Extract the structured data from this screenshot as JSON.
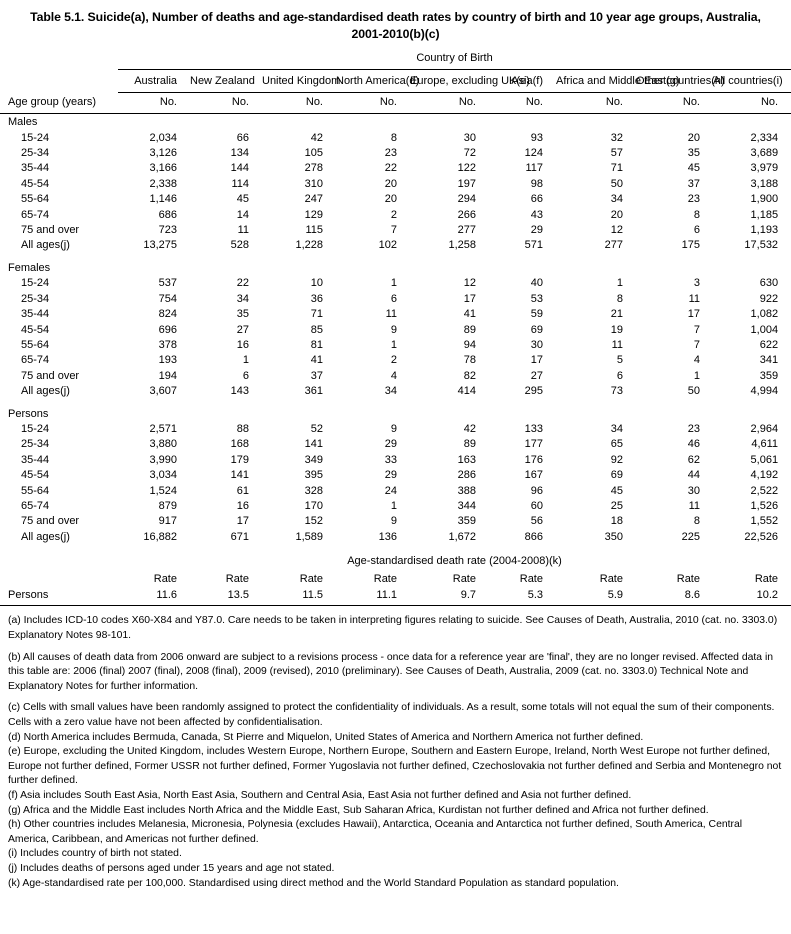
{
  "title": "Table 5.1. Suicide(a), Number of deaths and age-standardised death rates by country of birth and 10 year age groups, Australia, 2001-2010(b)(c)",
  "table": {
    "spanner_label": "Country of Birth",
    "stub_header": "Age group (years)",
    "columns": [
      "Australia",
      "New Zealand",
      "United Kingdom",
      "North America(d)",
      "Europe, excluding UK(e)",
      "Asia(f)",
      "Africa and Middle East(g)",
      "Other countries(h)",
      "All countries(i)"
    ],
    "unit_no": "No.",
    "unit_rate": "Rate",
    "rate_spanner_label": "Age-standardised death rate (2004-2008)(k)",
    "rate_row_label": "Persons",
    "rate_values": [
      "11.6",
      "13.5",
      "11.5",
      "11.1",
      "9.7",
      "5.3",
      "5.9",
      "8.6",
      "10.2"
    ],
    "groups": [
      {
        "name": "Males",
        "rows": [
          {
            "label": "15-24",
            "total": false,
            "values": [
              "2,034",
              "66",
              "42",
              "8",
              "30",
              "93",
              "32",
              "20",
              "2,334"
            ]
          },
          {
            "label": "25-34",
            "total": false,
            "values": [
              "3,126",
              "134",
              "105",
              "23",
              "72",
              "124",
              "57",
              "35",
              "3,689"
            ]
          },
          {
            "label": "35-44",
            "total": false,
            "values": [
              "3,166",
              "144",
              "278",
              "22",
              "122",
              "117",
              "71",
              "45",
              "3,979"
            ]
          },
          {
            "label": "45-54",
            "total": false,
            "values": [
              "2,338",
              "114",
              "310",
              "20",
              "197",
              "98",
              "50",
              "37",
              "3,188"
            ]
          },
          {
            "label": "55-64",
            "total": false,
            "values": [
              "1,146",
              "45",
              "247",
              "20",
              "294",
              "66",
              "34",
              "23",
              "1,900"
            ]
          },
          {
            "label": "65-74",
            "total": false,
            "values": [
              "686",
              "14",
              "129",
              "2",
              "266",
              "43",
              "20",
              "8",
              "1,185"
            ]
          },
          {
            "label": "75 and over",
            "total": false,
            "values": [
              "723",
              "11",
              "115",
              "7",
              "277",
              "29",
              "12",
              "6",
              "1,193"
            ]
          },
          {
            "label": "All ages(j)",
            "total": true,
            "values": [
              "13,275",
              "528",
              "1,228",
              "102",
              "1,258",
              "571",
              "277",
              "175",
              "17,532"
            ]
          }
        ]
      },
      {
        "name": "Females",
        "rows": [
          {
            "label": "15-24",
            "total": false,
            "values": [
              "537",
              "22",
              "10",
              "1",
              "12",
              "40",
              "1",
              "3",
              "630"
            ]
          },
          {
            "label": "25-34",
            "total": false,
            "values": [
              "754",
              "34",
              "36",
              "6",
              "17",
              "53",
              "8",
              "11",
              "922"
            ]
          },
          {
            "label": "35-44",
            "total": false,
            "values": [
              "824",
              "35",
              "71",
              "11",
              "41",
              "59",
              "21",
              "17",
              "1,082"
            ]
          },
          {
            "label": "45-54",
            "total": false,
            "values": [
              "696",
              "27",
              "85",
              "9",
              "89",
              "69",
              "19",
              "7",
              "1,004"
            ]
          },
          {
            "label": "55-64",
            "total": false,
            "values": [
              "378",
              "16",
              "81",
              "1",
              "94",
              "30",
              "11",
              "7",
              "622"
            ]
          },
          {
            "label": "65-74",
            "total": false,
            "values": [
              "193",
              "1",
              "41",
              "2",
              "78",
              "17",
              "5",
              "4",
              "341"
            ]
          },
          {
            "label": "75 and over",
            "total": false,
            "values": [
              "194",
              "6",
              "37",
              "4",
              "82",
              "27",
              "6",
              "1",
              "359"
            ]
          },
          {
            "label": "All ages(j)",
            "total": true,
            "values": [
              "3,607",
              "143",
              "361",
              "34",
              "414",
              "295",
              "73",
              "50",
              "4,994"
            ]
          }
        ]
      },
      {
        "name": "Persons",
        "rows": [
          {
            "label": "15-24",
            "total": false,
            "values": [
              "2,571",
              "88",
              "52",
              "9",
              "42",
              "133",
              "34",
              "23",
              "2,964"
            ]
          },
          {
            "label": "25-34",
            "total": false,
            "values": [
              "3,880",
              "168",
              "141",
              "29",
              "89",
              "177",
              "65",
              "46",
              "4,611"
            ]
          },
          {
            "label": "35-44",
            "total": false,
            "values": [
              "3,990",
              "179",
              "349",
              "33",
              "163",
              "176",
              "92",
              "62",
              "5,061"
            ]
          },
          {
            "label": "45-54",
            "total": false,
            "values": [
              "3,034",
              "141",
              "395",
              "29",
              "286",
              "167",
              "69",
              "44",
              "4,192"
            ]
          },
          {
            "label": "55-64",
            "total": false,
            "values": [
              "1,524",
              "61",
              "328",
              "24",
              "388",
              "96",
              "45",
              "30",
              "2,522"
            ]
          },
          {
            "label": "65-74",
            "total": false,
            "values": [
              "879",
              "16",
              "170",
              "1",
              "344",
              "60",
              "25",
              "11",
              "1,526"
            ]
          },
          {
            "label": "75 and over",
            "total": false,
            "values": [
              "917",
              "17",
              "152",
              "9",
              "359",
              "56",
              "18",
              "8",
              "1,552"
            ]
          },
          {
            "label": "All ages(j)",
            "total": true,
            "values": [
              "16,882",
              "671",
              "1,589",
              "136",
              "1,672",
              "866",
              "350",
              "225",
              "22,526"
            ]
          }
        ]
      }
    ]
  },
  "footnotes": [
    "(a) Includes ICD-10 codes X60-X84 and Y87.0. Care needs to be taken in interpreting figures relating to suicide. See Causes of Death, Australia, 2010 (cat. no. 3303.0) Explanatory Notes 98-101.",
    "(b) All causes of death data from 2006 onward are subject to a revisions process - once data for a reference year are 'final', they are no longer revised. Affected data in this table are: 2006 (final) 2007 (final), 2008 (final), 2009 (revised), 2010 (preliminary). See Causes of Death, Australia, 2009 (cat. no. 3303.0) Technical Note and Explanatory Notes for further information.",
    "(c) Cells with small values have been randomly assigned to protect the confidentiality of individuals. As a result, some totals will not equal the sum of their components. Cells with a zero value have not been affected by confidentialisation.",
    "(d) North America includes Bermuda, Canada, St Pierre and Miquelon, United States of America and Northern America not further defined.",
    "(e) Europe, excluding the United Kingdom, includes Western Europe, Northern Europe, Southern and Eastern Europe, Ireland, North West Europe not further defined, Europe not further defined, Former USSR not further defined, Former Yugoslavia not further defined, Czechoslovakia not further defined and Serbia and Montenegro not further defined.",
    "(f) Asia includes South East Asia, North East Asia, Southern and Central Asia, East Asia not further defined and Asia not further defined.",
    "(g) Africa and the Middle East includes North Africa and the Middle East, Sub Saharan Africa, Kurdistan not further defined and Africa not further defined.",
    "(h) Other countries includes Melanesia, Micronesia, Polynesia (excludes Hawaii), Antarctica, Oceania and Antarctica not further defined, South America, Central America, Caribbean, and Americas not further defined.",
    "(i) Includes country of birth not stated.",
    "(j) Includes deaths of persons aged under 15 years and age not stated.",
    "(k) Age-standardised rate per 100,000. Standardised using direct method and the World Standard Population as standard population."
  ]
}
